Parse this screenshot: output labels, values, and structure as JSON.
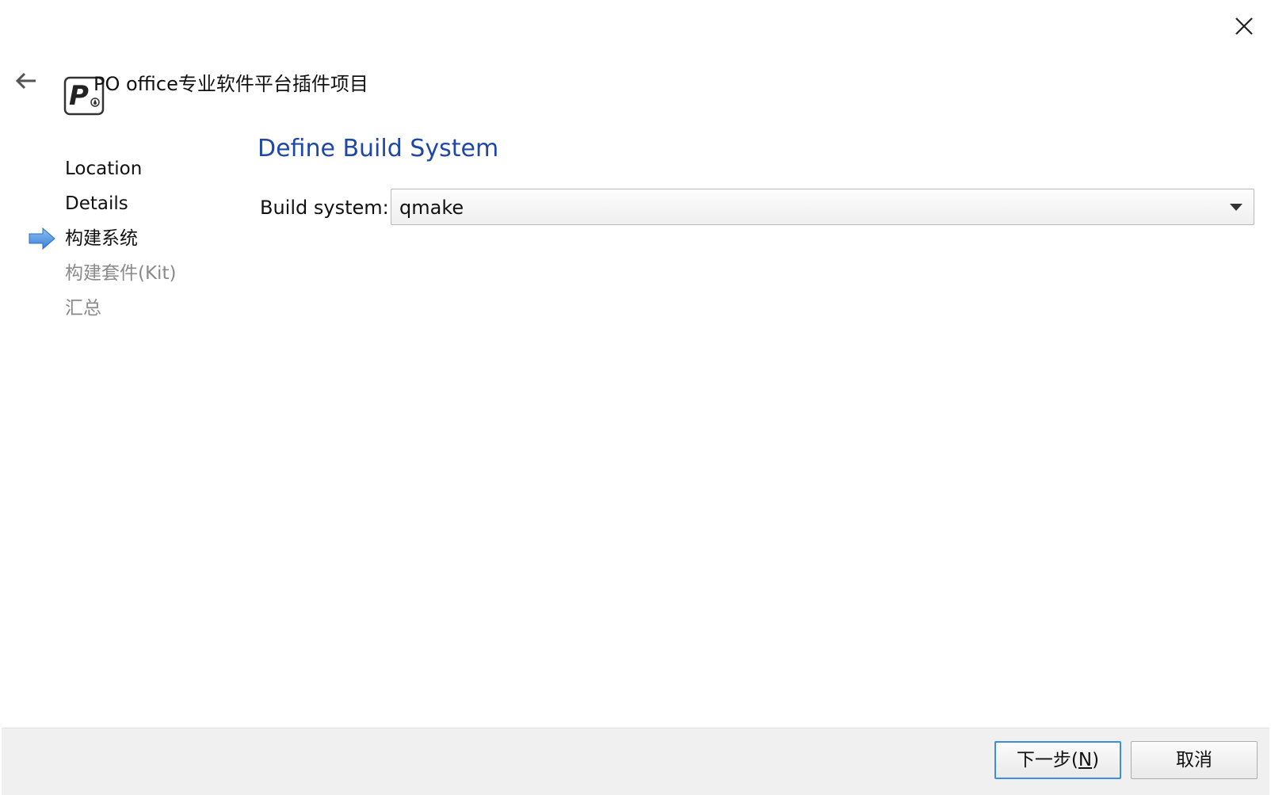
{
  "window": {
    "title": "PO office专业软件平台插件项目",
    "close_icon": "close-icon",
    "back_icon": "back-arrow-icon"
  },
  "steps": [
    {
      "label": "Location",
      "state": "done"
    },
    {
      "label": "Details",
      "state": "done"
    },
    {
      "label": "构建系统",
      "state": "current"
    },
    {
      "label": "构建套件(Kit)",
      "state": "pending"
    },
    {
      "label": "汇总",
      "state": "pending"
    }
  ],
  "page": {
    "heading": "Define Build System",
    "build_system_label": "Build system:",
    "build_system_value": "qmake"
  },
  "footer": {
    "next_label_pre": "下一步(",
    "next_mnemonic": "N",
    "next_label_post": ")",
    "cancel_label": "取消"
  },
  "colors": {
    "heading": "#1f47a8",
    "current_step_arrow": "#4a8fe0",
    "pending_step": "#8a8a8a",
    "primary_button_border": "#3d8ee0"
  }
}
